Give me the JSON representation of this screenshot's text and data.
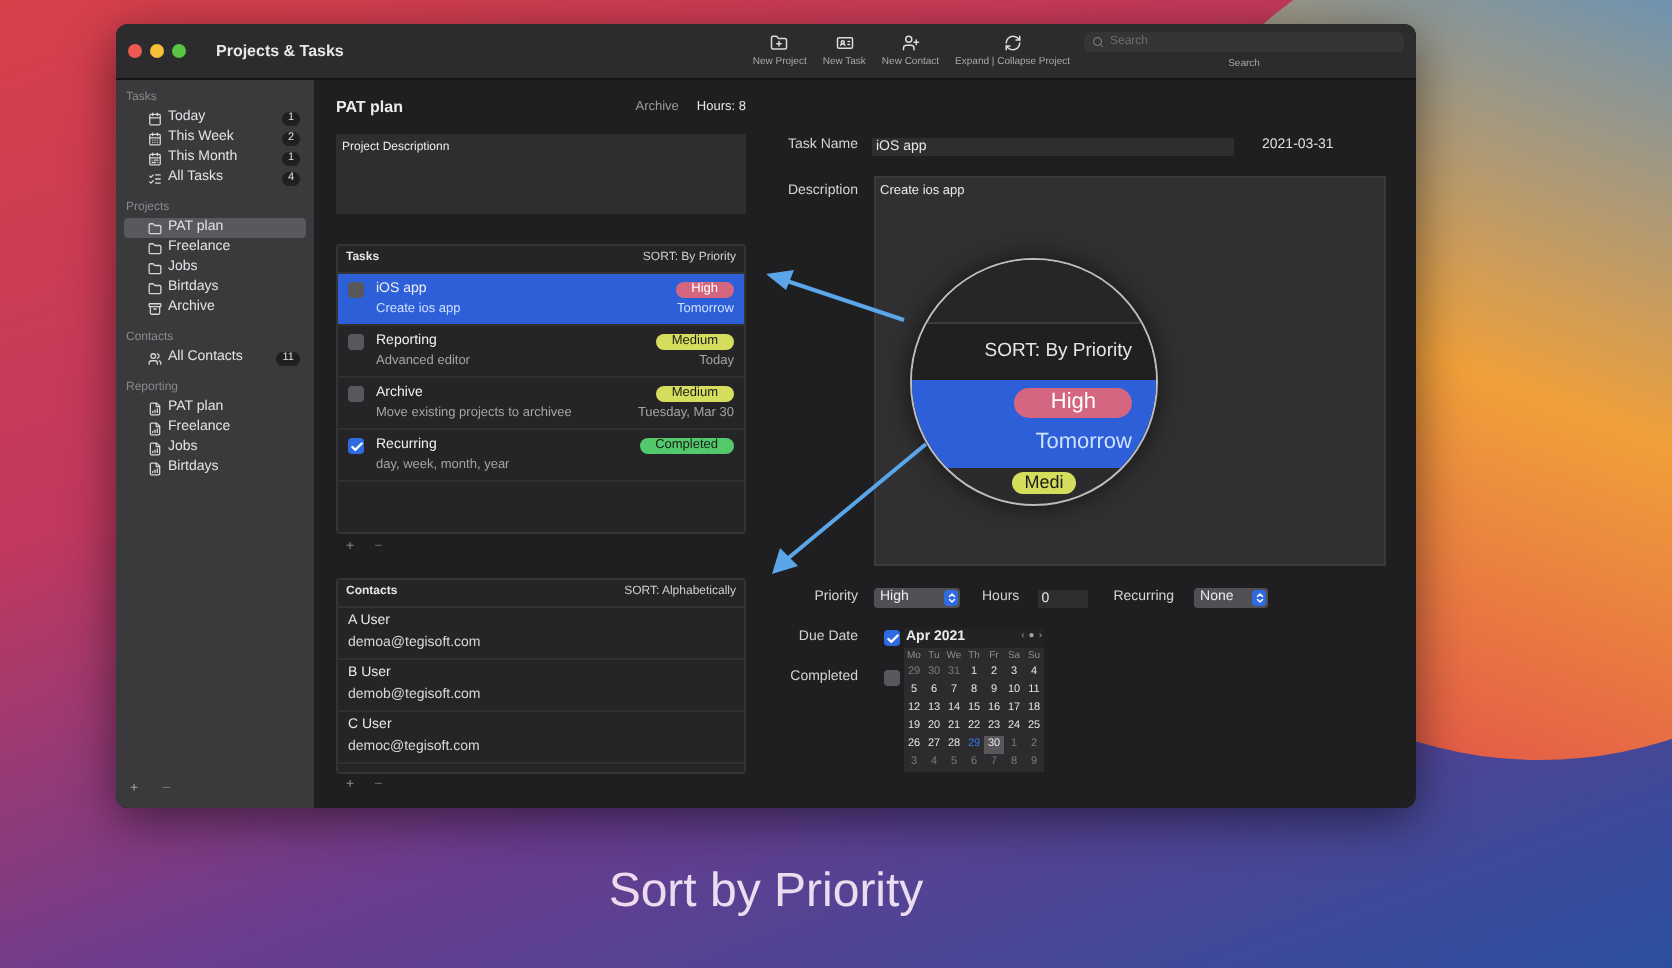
{
  "window": {
    "title": "Projects & Tasks"
  },
  "toolbar": {
    "buttons": [
      {
        "label": "New Project",
        "kind": "project"
      },
      {
        "label": "New Task",
        "kind": "task"
      },
      {
        "label": "New Contact",
        "kind": "contact"
      },
      {
        "label": "Expand | Collapse Project",
        "kind": "expand"
      }
    ],
    "search": {
      "placeholder": "Search",
      "label": "Search"
    }
  },
  "sidebar": {
    "sections": [
      {
        "title": "Tasks",
        "items": [
          {
            "label": "Today",
            "kind": "day",
            "count": "1",
            "selected": false
          },
          {
            "label": "This Week",
            "kind": "week",
            "count": "2",
            "selected": false
          },
          {
            "label": "This Month",
            "kind": "month",
            "count": "1",
            "selected": false
          },
          {
            "label": "All Tasks",
            "kind": "all",
            "count": "4",
            "selected": false
          }
        ]
      },
      {
        "title": "Projects",
        "items": [
          {
            "label": "PAT plan",
            "kind": "folder",
            "selected": true
          },
          {
            "label": "Freelance",
            "kind": "folder",
            "selected": false
          },
          {
            "label": "Jobs",
            "kind": "folder",
            "selected": false
          },
          {
            "label": "Birtdays",
            "kind": "folder",
            "selected": false
          },
          {
            "label": "Archive",
            "kind": "archive",
            "selected": false
          }
        ]
      },
      {
        "title": "Contacts",
        "items": [
          {
            "label": "All Contacts",
            "kind": "contacts",
            "count": "11",
            "selected": false
          }
        ]
      },
      {
        "title": "Reporting",
        "items": [
          {
            "label": "PAT plan",
            "kind": "report",
            "selected": false
          },
          {
            "label": "Freelance",
            "kind": "report",
            "selected": false
          },
          {
            "label": "Jobs",
            "kind": "report",
            "selected": false
          },
          {
            "label": "Birtdays",
            "kind": "report",
            "selected": false
          }
        ]
      }
    ],
    "add": "+",
    "remove": "−"
  },
  "project": {
    "title": "PAT plan",
    "archive": "Archive",
    "hours": "Hours: 8",
    "description": "Project Descriptionn"
  },
  "tasks": {
    "title": "Tasks",
    "sort": "SORT: By Priority",
    "add": "+",
    "remove": "−",
    "items": [
      {
        "title": "iOS app",
        "subtitle": "Create ios app",
        "badge": "High",
        "color": "#d4667f",
        "due": "Tomorrow",
        "checked": false,
        "selected": true
      },
      {
        "title": "Reporting",
        "subtitle": "Advanced editor",
        "badge": "Medium",
        "color": "#d5dd5c",
        "due": "Today",
        "checked": false,
        "selected": false
      },
      {
        "title": "Archive",
        "subtitle": "Move existing projects to archivee",
        "badge": "Medium",
        "color": "#d5dd5c",
        "due": "Tuesday, Mar 30",
        "checked": false,
        "selected": false
      },
      {
        "title": "Recurring",
        "subtitle": "day, week, month, year",
        "badge": "Completed",
        "color": "#52c96a",
        "checked": true,
        "selected": false
      }
    ]
  },
  "contacts": {
    "title": "Contacts",
    "sort": "SORT: Alphabetically",
    "add": "+",
    "remove": "−",
    "items": [
      {
        "name": "A User",
        "email": "demoa@tegisoft.com"
      },
      {
        "name": "B User",
        "email": "demob@tegisoft.com"
      },
      {
        "name": "C User",
        "email": "democ@tegisoft.com"
      }
    ]
  },
  "task_detail": {
    "name_label": "Task Name",
    "name": "iOS app",
    "date": "2021-03-31",
    "description_label": "Description",
    "description": "Create ios app",
    "priority_label": "Priority",
    "priority": "High",
    "hours_label": "Hours",
    "hours": "0",
    "recurring_label": "Recurring",
    "recurring": "None",
    "due_label": "Due Date",
    "due_checked": true,
    "completed_label": "Completed",
    "completed_checked": false
  },
  "calendar": {
    "month": "Apr 2021",
    "prev": "‹",
    "today": "●",
    "next": "›",
    "weekdays": [
      "Mo",
      "Tu",
      "We",
      "Th",
      "Fr",
      "Sa",
      "Su"
    ],
    "days": [
      {
        "day": "29",
        "muted": true,
        "today": false,
        "selected": false
      },
      {
        "day": "30",
        "muted": true,
        "today": false,
        "selected": false
      },
      {
        "day": "31",
        "muted": true,
        "today": false,
        "selected": false
      },
      {
        "day": "1",
        "muted": false,
        "today": false,
        "selected": false
      },
      {
        "day": "2",
        "muted": false,
        "today": false,
        "selected": false
      },
      {
        "day": "3",
        "muted": false,
        "today": false,
        "selected": false
      },
      {
        "day": "4",
        "muted": false,
        "today": false,
        "selected": false
      },
      {
        "day": "5",
        "muted": false,
        "today": false,
        "selected": false
      },
      {
        "day": "6",
        "muted": false,
        "today": false,
        "selected": false
      },
      {
        "day": "7",
        "muted": false,
        "today": false,
        "selected": false
      },
      {
        "day": "8",
        "muted": false,
        "today": false,
        "selected": false
      },
      {
        "day": "9",
        "muted": false,
        "today": false,
        "selected": false
      },
      {
        "day": "10",
        "muted": false,
        "today": false,
        "selected": false
      },
      {
        "day": "11",
        "muted": false,
        "today": false,
        "selected": false
      },
      {
        "day": "12",
        "muted": false,
        "today": false,
        "selected": false
      },
      {
        "day": "13",
        "muted": false,
        "today": false,
        "selected": false
      },
      {
        "day": "14",
        "muted": false,
        "today": false,
        "selected": false
      },
      {
        "day": "15",
        "muted": false,
        "today": false,
        "selected": false
      },
      {
        "day": "16",
        "muted": false,
        "today": false,
        "selected": false
      },
      {
        "day": "17",
        "muted": false,
        "today": false,
        "selected": false
      },
      {
        "day": "18",
        "muted": false,
        "today": false,
        "selected": false
      },
      {
        "day": "19",
        "muted": false,
        "today": false,
        "selected": false
      },
      {
        "day": "20",
        "muted": false,
        "today": false,
        "selected": false
      },
      {
        "day": "21",
        "muted": false,
        "today": false,
        "selected": false
      },
      {
        "day": "22",
        "muted": false,
        "today": false,
        "selected": false
      },
      {
        "day": "23",
        "muted": false,
        "today": false,
        "selected": false
      },
      {
        "day": "24",
        "muted": false,
        "today": false,
        "selected": false
      },
      {
        "day": "25",
        "muted": false,
        "today": false,
        "selected": false
      },
      {
        "day": "26",
        "muted": false,
        "today": false,
        "selected": false
      },
      {
        "day": "27",
        "muted": false,
        "today": false,
        "selected": false
      },
      {
        "day": "28",
        "muted": false,
        "today": false,
        "selected": false
      },
      {
        "day": "29",
        "muted": false,
        "today": true,
        "selected": false
      },
      {
        "day": "30",
        "muted": false,
        "today": false,
        "selected": true
      },
      {
        "day": "1",
        "muted": true,
        "today": false,
        "selected": false
      },
      {
        "day": "2",
        "muted": true,
        "today": false,
        "selected": false
      },
      {
        "day": "3",
        "muted": true,
        "today": false,
        "selected": false
      },
      {
        "day": "4",
        "muted": true,
        "today": false,
        "selected": false
      },
      {
        "day": "5",
        "muted": true,
        "today": false,
        "selected": false
      },
      {
        "day": "6",
        "muted": true,
        "today": false,
        "selected": false
      },
      {
        "day": "7",
        "muted": true,
        "today": false,
        "selected": false
      },
      {
        "day": "8",
        "muted": true,
        "today": false,
        "selected": false
      },
      {
        "day": "9",
        "muted": true,
        "today": false,
        "selected": false
      }
    ]
  },
  "magnifier": {
    "sort": "SORT: By Priority",
    "due": "Tomorrow",
    "badges": [
      {
        "label": "High",
        "color": "#d4667f"
      },
      {
        "label": "Medi",
        "color": "#d5dd5c"
      }
    ]
  },
  "caption": "Sort by Priority"
}
